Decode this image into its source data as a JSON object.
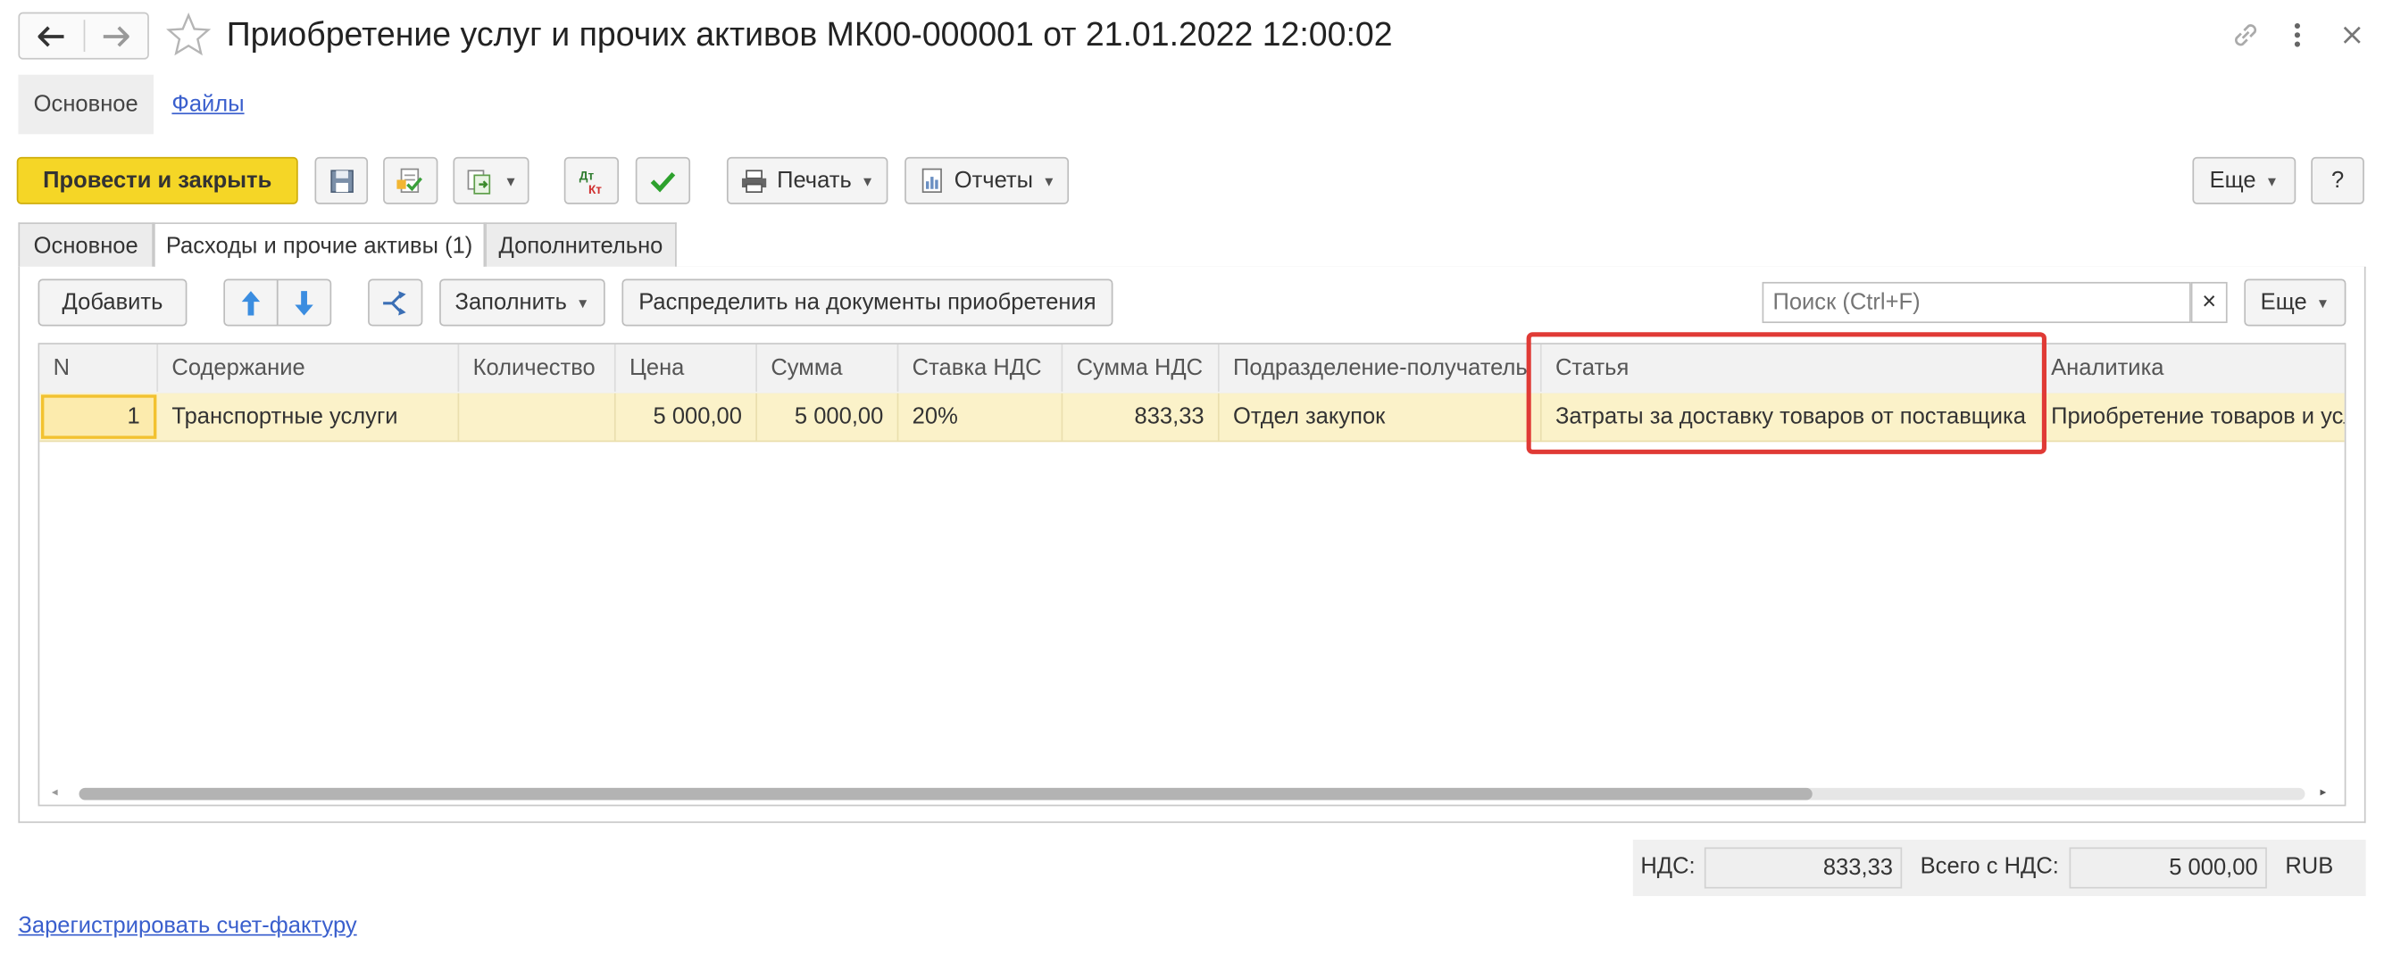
{
  "window": {
    "title": "Приобретение услуг и прочих активов МК00-000001 от 21.01.2022 12:00:02"
  },
  "top_nav": {
    "main": "Основное",
    "files": "Файлы"
  },
  "toolbar": {
    "post_close": "Провести и закрыть",
    "print": "Печать",
    "reports": "Отчеты",
    "more": "Еще",
    "help": "?"
  },
  "tabs": [
    {
      "label": "Основное"
    },
    {
      "label": "Расходы и прочие активы (1)"
    },
    {
      "label": "Дополнительно"
    }
  ],
  "table_toolbar": {
    "add": "Добавить",
    "fill": "Заполнить",
    "distribute": "Распределить на документы приобретения",
    "search_placeholder": "Поиск (Ctrl+F)",
    "clear": "×",
    "more": "Еще"
  },
  "table": {
    "columns": [
      "N",
      "Содержание",
      "Количество",
      "Цена",
      "Сумма",
      "Ставка НДС",
      "Сумма НДС",
      "Подразделение-получатель",
      "Статья",
      "Аналитика"
    ],
    "rows": [
      [
        "1",
        "Транспортные услуги",
        "",
        "5 000,00",
        "5 000,00",
        "20%",
        "833,33",
        "Отдел закупок",
        "Затраты за доставку товаров от поставщика",
        "Приобретение товаров и усл"
      ]
    ]
  },
  "totals": {
    "vat_label": "НДС:",
    "vat_value": "833,33",
    "total_label": "Всего с НДС:",
    "total_value": "5 000,00",
    "currency": "RUB"
  },
  "footer": {
    "register_invoice": "Зарегистрировать счет-фактуру"
  },
  "colors": {
    "primary_button": "#f5d626",
    "selected_row": "#fbf2c9",
    "highlight_box": "#e03a35",
    "link": "#3a5fcd"
  }
}
